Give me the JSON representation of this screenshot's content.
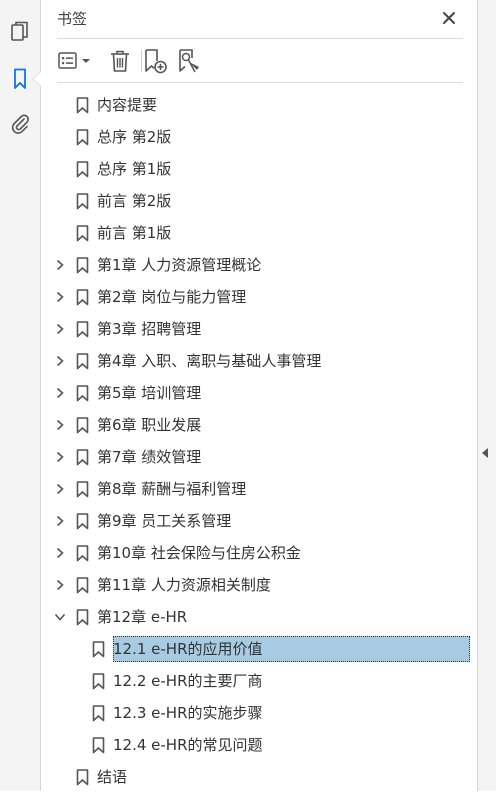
{
  "panel": {
    "title": "书签"
  },
  "rail": {
    "items": [
      "pages-icon",
      "bookmarks-icon",
      "attachments-icon"
    ]
  },
  "toolbar": {
    "buttons": [
      "options-menu",
      "delete-bookmark",
      "new-bookmark",
      "new-bookmark-from-structure"
    ]
  },
  "bookmarks": [
    {
      "label": "内容提要",
      "level": 0,
      "expandable": false
    },
    {
      "label": "总序 第2版",
      "level": 0,
      "expandable": false
    },
    {
      "label": "总序 第1版",
      "level": 0,
      "expandable": false
    },
    {
      "label": "前言 第2版",
      "level": 0,
      "expandable": false
    },
    {
      "label": "前言 第1版",
      "level": 0,
      "expandable": false
    },
    {
      "label": "第1章 人力资源管理概论",
      "level": 0,
      "expandable": true,
      "expanded": false
    },
    {
      "label": "第2章 岗位与能力管理",
      "level": 0,
      "expandable": true,
      "expanded": false
    },
    {
      "label": "第3章 招聘管理",
      "level": 0,
      "expandable": true,
      "expanded": false
    },
    {
      "label": "第4章 入职、离职与基础人事管理",
      "level": 0,
      "expandable": true,
      "expanded": false
    },
    {
      "label": "第5章 培训管理",
      "level": 0,
      "expandable": true,
      "expanded": false
    },
    {
      "label": "第6章 职业发展",
      "level": 0,
      "expandable": true,
      "expanded": false
    },
    {
      "label": "第7章 绩效管理",
      "level": 0,
      "expandable": true,
      "expanded": false
    },
    {
      "label": "第8章 薪酬与福利管理",
      "level": 0,
      "expandable": true,
      "expanded": false
    },
    {
      "label": "第9章 员工关系管理",
      "level": 0,
      "expandable": true,
      "expanded": false
    },
    {
      "label": "第10章 社会保险与住房公积金",
      "level": 0,
      "expandable": true,
      "expanded": false
    },
    {
      "label": "第11章 人力资源相关制度",
      "level": 0,
      "expandable": true,
      "expanded": false
    },
    {
      "label": "第12章 e-HR",
      "level": 0,
      "expandable": true,
      "expanded": true
    },
    {
      "label": "12.1 e-HR的应用价值",
      "level": 1,
      "expandable": false,
      "selected": true
    },
    {
      "label": "12.2 e-HR的主要厂商",
      "level": 1,
      "expandable": false
    },
    {
      "label": "12.3 e-HR的实施步骤",
      "level": 1,
      "expandable": false
    },
    {
      "label": "12.4 e-HR的常见问题",
      "level": 1,
      "expandable": false
    },
    {
      "label": "结语",
      "level": 0,
      "expandable": false
    }
  ],
  "colors": {
    "selection": "#a7cbe2",
    "accent": "#1473e6"
  }
}
